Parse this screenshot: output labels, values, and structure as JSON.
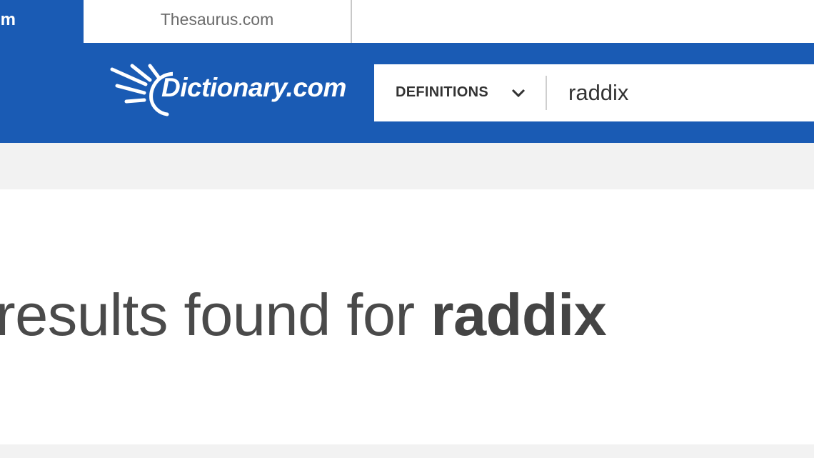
{
  "tabs": [
    {
      "label": "m",
      "active": true
    },
    {
      "label": "Thesaurus.com",
      "active": false
    }
  ],
  "header": {
    "logo_text": "Dictionary.com",
    "search": {
      "dropdown_label": "DEFINITIONS",
      "query": "raddix"
    }
  },
  "main": {
    "heading_prefix": "results found for",
    "heading_term": "raddix"
  },
  "colors": {
    "brand_blue": "#1a5bb4",
    "background_gray": "#f2f2f2",
    "text_dark": "#4a4a4a"
  }
}
